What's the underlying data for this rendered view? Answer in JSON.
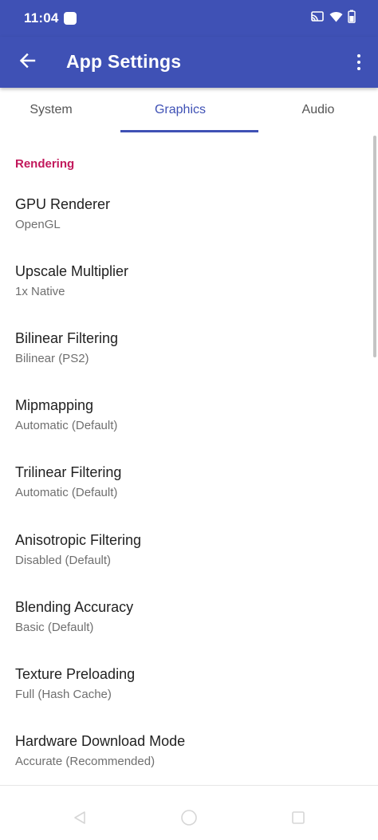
{
  "status_bar": {
    "time": "11:04",
    "icons": [
      "notification-icon",
      "cast-icon",
      "wifi-icon",
      "battery-icon"
    ]
  },
  "app_bar": {
    "title": "App Settings",
    "back_icon": "arrow-back-icon",
    "overflow_icon": "more-vert-icon"
  },
  "tabs": [
    {
      "label": "System",
      "selected": false
    },
    {
      "label": "Graphics",
      "selected": true
    },
    {
      "label": "Audio",
      "selected": false
    }
  ],
  "section": {
    "title": "Rendering"
  },
  "preferences": [
    {
      "title": "GPU Renderer",
      "summary": "OpenGL"
    },
    {
      "title": "Upscale Multiplier",
      "summary": "1x Native"
    },
    {
      "title": "Bilinear Filtering",
      "summary": "Bilinear (PS2)"
    },
    {
      "title": "Mipmapping",
      "summary": "Automatic (Default)"
    },
    {
      "title": "Trilinear Filtering",
      "summary": "Automatic (Default)"
    },
    {
      "title": "Anisotropic Filtering",
      "summary": "Disabled (Default)"
    },
    {
      "title": "Blending Accuracy",
      "summary": "Basic (Default)"
    },
    {
      "title": "Texture Preloading",
      "summary": "Full (Hash Cache)"
    },
    {
      "title": "Hardware Download Mode",
      "summary": "Accurate (Recommended)"
    }
  ],
  "colors": {
    "primary": "#3f51b5",
    "category": "#c2185b",
    "title_text": "#212121",
    "summary_text": "#6f6f6f"
  },
  "nav_bar": {
    "icons": [
      "back-triangle-icon",
      "home-circle-icon",
      "recents-square-icon"
    ]
  }
}
